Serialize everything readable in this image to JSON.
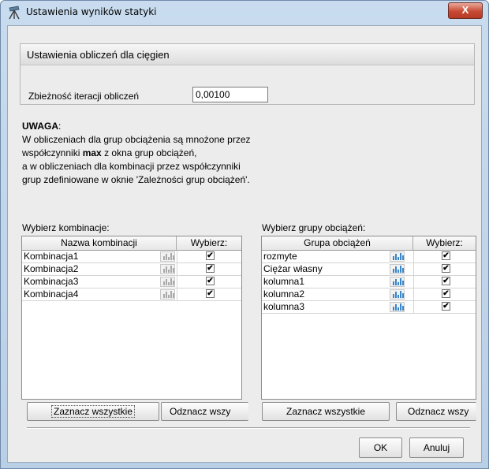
{
  "window": {
    "title": "Ustawienia wyników statyki",
    "close_symbol": "X"
  },
  "calc_settings": {
    "header": "Ustawienia obliczeń dla cięgien",
    "convergence_label": "Zbieżność iteracji obliczeń",
    "convergence_value": "0,00100"
  },
  "note": {
    "title": "UWAGA",
    "line1": "W obliczeniach dla grup obciążenia są mnożone przez",
    "line2_before": "współczynniki ",
    "line2_bold": "max",
    "line2_after": " z okna grup obciążeń,",
    "line3": "a w obliczeniach dla kombinacji przez współczynniki",
    "line4": "grup zdefiniowane w oknie 'Zależności grup obciążeń'."
  },
  "combinations": {
    "label": "Wybierz kombinacje:",
    "col_name": "Nazwa kombinacji",
    "col_select": "Wybierz:",
    "rows": [
      {
        "name": "Kombinacja1",
        "checked": true
      },
      {
        "name": "Kombinacja2",
        "checked": true
      },
      {
        "name": "Kombinacja3",
        "checked": true
      },
      {
        "name": "Kombinacja4",
        "checked": true
      }
    ],
    "select_all": "Zaznacz wszystkie",
    "deselect_all": "Odznacz wszy"
  },
  "load_groups": {
    "label": "Wybierz grupy obciążeń:",
    "col_name": "Grupa obciążeń",
    "col_select": "Wybierz:",
    "rows": [
      {
        "name": "rozmyte",
        "checked": true
      },
      {
        "name": "Ciężar własny",
        "checked": true
      },
      {
        "name": "kolumna1",
        "checked": true
      },
      {
        "name": "kolumna2",
        "checked": true
      },
      {
        "name": "kolumna3",
        "checked": true
      }
    ],
    "select_all": "Zaznacz wszystkie",
    "deselect_all": "Odznacz wszy"
  },
  "footer": {
    "ok": "OK",
    "cancel": "Anuluj"
  },
  "check_mark": "✔",
  "colors": {
    "accent_bar_active": "#3a86c8",
    "accent_bar_inactive": "#a9a9a9"
  },
  "icons": {
    "app": "tripod-icon",
    "row_button": "chart-bars-icon"
  }
}
